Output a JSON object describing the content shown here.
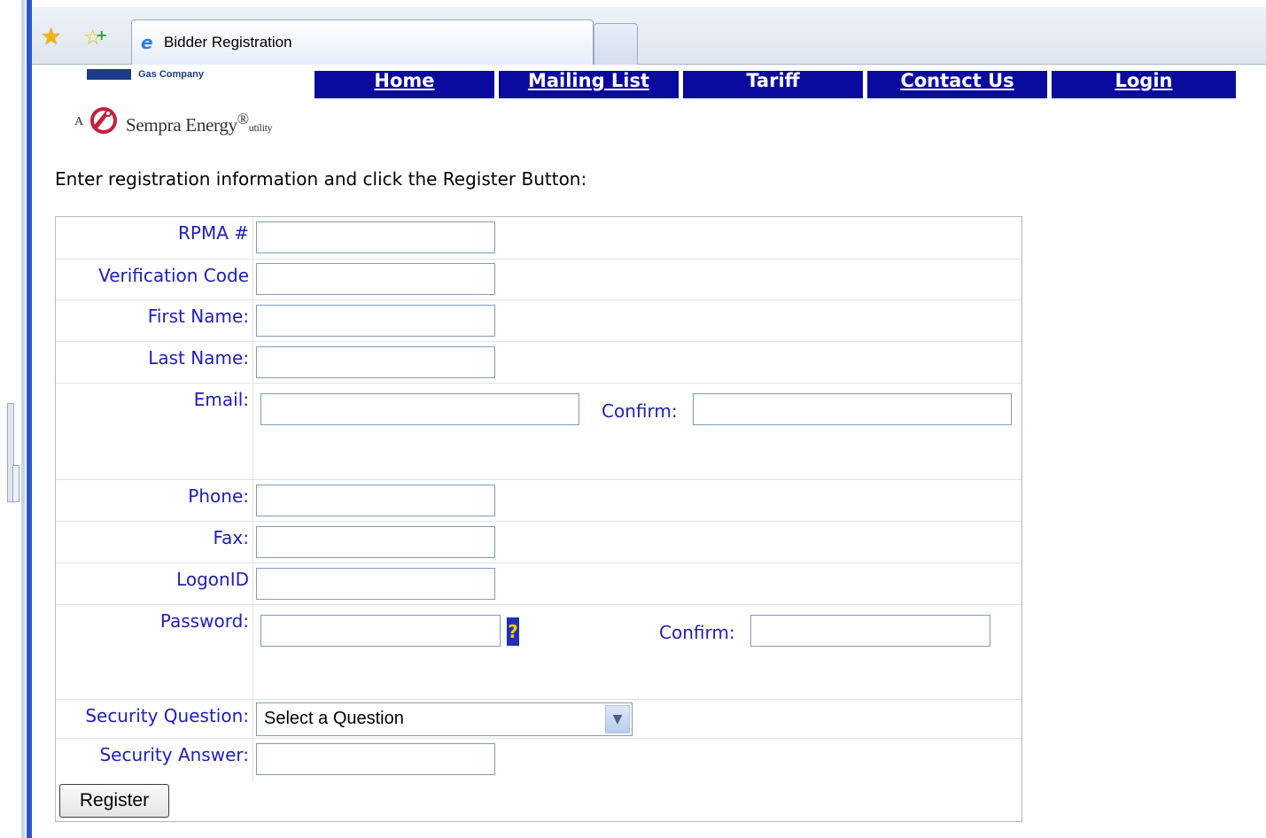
{
  "browser": {
    "tab_title": "Bidder Registration"
  },
  "header": {
    "logo_company_text": "Gas Company",
    "logo_prefix": "A",
    "logo_name": "Sempra Energy",
    "logo_suffix": "utility"
  },
  "nav": {
    "items": [
      {
        "label": "Home"
      },
      {
        "label": "Mailing List"
      },
      {
        "label": "Tariff"
      },
      {
        "label": "Contact Us"
      },
      {
        "label": "Login"
      }
    ],
    "background_color": "#0a0a9e"
  },
  "instructions": "Enter registration information and click the Register Button:",
  "form": {
    "rpma_label": "RPMA #",
    "verification_label": "Verification Code",
    "first_name_label": "First Name:",
    "last_name_label": "Last Name:",
    "email_label": "Email:",
    "email_confirm_label": "Confirm:",
    "phone_label": "Phone:",
    "fax_label": "Fax:",
    "logon_label": "LogonID",
    "password_label": "Password:",
    "password_help": "?",
    "password_confirm_label": "Confirm:",
    "security_question_label": "Security Question:",
    "security_question_selected": "Select a Question",
    "security_answer_label": "Security Answer:",
    "register_button": "Register",
    "label_color": "#2020b8"
  }
}
